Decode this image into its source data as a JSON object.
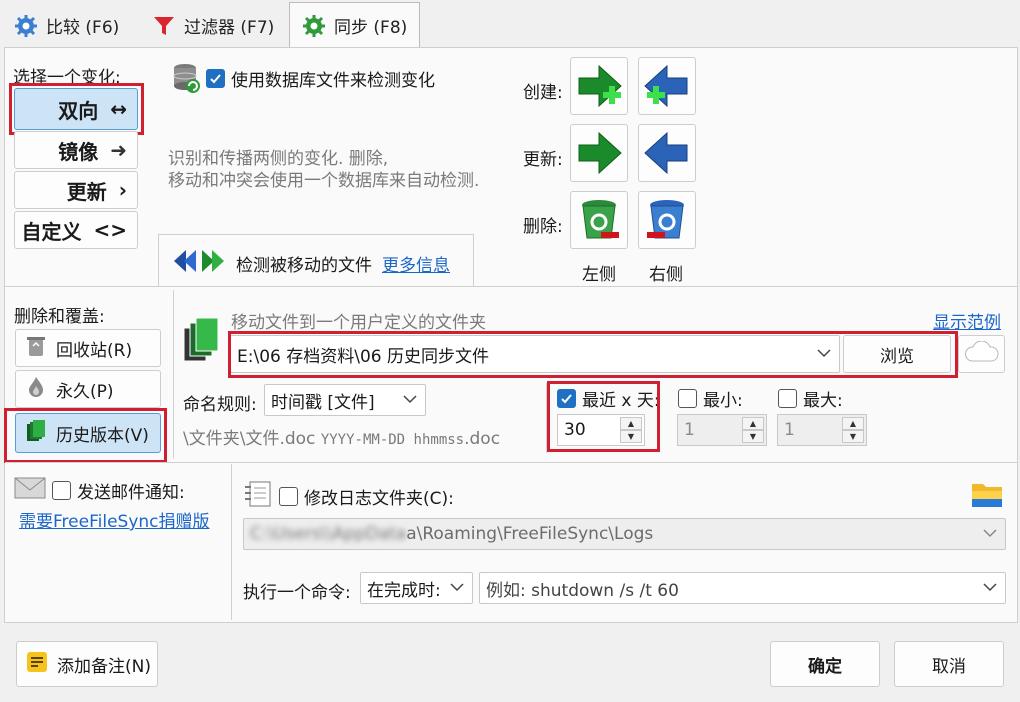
{
  "tabs": [
    {
      "label": "比较 (F6)",
      "icon": "gear-blue-icon"
    },
    {
      "label": "过滤器 (F7)",
      "icon": "funnel-icon"
    },
    {
      "label": "同步 (F8)",
      "icon": "gear-green-icon"
    }
  ],
  "variant": {
    "title": "选择一个变化:",
    "buttons": [
      {
        "label": "双向",
        "symbol": "↔",
        "selected": true
      },
      {
        "label": "镜像",
        "symbol": "➜",
        "selected": false
      },
      {
        "label": "更新",
        "symbol": "›",
        "selected": false
      },
      {
        "label": "自定义",
        "symbol": "<>",
        "selected": false
      }
    ]
  },
  "db_check": {
    "label": "使用数据库文件来检测变化",
    "checked": true
  },
  "description": [
    "识别和传播两侧的变化. 删除,",
    "移动和冲突会使用一个数据库来自动检测."
  ],
  "moved": {
    "label": "检测被移动的文件",
    "link": "更多信息"
  },
  "actions": {
    "create": "创建:",
    "update": "更新:",
    "delete": "删除:",
    "left": "左侧",
    "right": "右侧"
  },
  "deletion": {
    "title": "删除和覆盖:",
    "buttons": [
      {
        "label": "回收站(R)",
        "icon": "recycle-bin-icon",
        "selected": false
      },
      {
        "label": "永久(P)",
        "icon": "flame-icon",
        "selected": false
      },
      {
        "label": "历史版本(V)",
        "icon": "versions-icon",
        "selected": true
      }
    ]
  },
  "versioning": {
    "hint": "移动文件到一个用户定义的文件夹",
    "show_example": "显示范例",
    "folder": "E:\\06 存档资料\\06 历史同步文件",
    "browse": "浏览",
    "naming_label": "命名规则:",
    "naming_value": "时间戳 [文件]",
    "naming_example_prefix": "\\文件夹\\文件.doc ",
    "naming_example_mono": "YYYY-MM-DD hhmmss",
    "naming_example_suffix": ".doc",
    "last_x_days": {
      "label": "最近 x 天:",
      "checked": true,
      "value": "30"
    },
    "min": {
      "label": "最小:",
      "checked": false,
      "value": "1"
    },
    "max": {
      "label": "最大:",
      "checked": false,
      "value": "1"
    }
  },
  "email": {
    "label": "发送邮件通知:",
    "checked": false,
    "link": "需要FreeFileSync捐赠版"
  },
  "log": {
    "label": "修改日志文件夹(C):",
    "checked": false,
    "path": "\\Roaming\\FreeFileSync\\Logs",
    "path_blur_a": "C:\\Users\\",
    "path_blur_b": "\\AppData",
    "path_mid": "a"
  },
  "command": {
    "label": "执行一个命令:",
    "when": "在完成时:",
    "placeholder": "例如: shutdown /s /t 60"
  },
  "footer": {
    "add_note": "添加备注(N)",
    "ok": "确定",
    "cancel": "取消"
  },
  "colors": {
    "accent": "#1f6fc3",
    "highlight": "#d01f30",
    "selected_bg": "#cde4f7",
    "link": "#1b66c9"
  }
}
